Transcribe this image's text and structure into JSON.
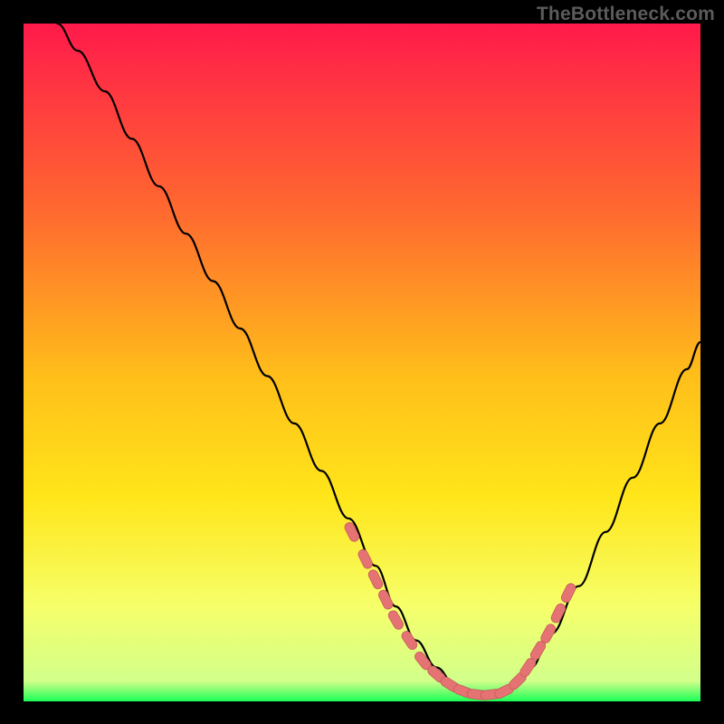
{
  "watermark": "TheBottleneck.com",
  "colors": {
    "bg_black": "#000000",
    "grad_top": "#ff1a4b",
    "grad_mid1": "#ff6a2f",
    "grad_mid2": "#ffbe1a",
    "grad_mid3": "#ffe61a",
    "grad_low": "#f6ff6a",
    "grad_green": "#1aff57",
    "curve": "#000000",
    "marker": "#e57373",
    "marker_stroke": "#c85a5a"
  },
  "chart_data": {
    "type": "line",
    "title": "",
    "xlabel": "",
    "ylabel": "",
    "xlim": [
      0,
      100
    ],
    "ylim": [
      0,
      100
    ],
    "series": [
      {
        "name": "bottleneck-curve",
        "x": [
          5,
          8,
          12,
          16,
          20,
          24,
          28,
          32,
          36,
          40,
          44,
          48,
          52,
          55,
          58,
          61,
          64,
          67,
          70,
          72,
          75,
          78,
          82,
          86,
          90,
          94,
          98,
          100
        ],
        "y": [
          100,
          96,
          90,
          83,
          76,
          69,
          62,
          55,
          48,
          41,
          34,
          27,
          20,
          14,
          9,
          5,
          2,
          1,
          1,
          2,
          5,
          10,
          17,
          25,
          33,
          41,
          49,
          53
        ]
      }
    ],
    "markers": {
      "name": "highlight-dots",
      "x": [
        48.5,
        50.5,
        52,
        53.5,
        55,
        57,
        59,
        61,
        63,
        65,
        67,
        69,
        71,
        73,
        74.5,
        76,
        77.5,
        79,
        80.5
      ],
      "y": [
        25,
        21,
        18,
        15,
        12,
        9,
        6,
        4,
        2.5,
        1.5,
        1,
        1,
        1.5,
        3,
        5,
        7.5,
        10,
        13,
        16
      ]
    }
  }
}
